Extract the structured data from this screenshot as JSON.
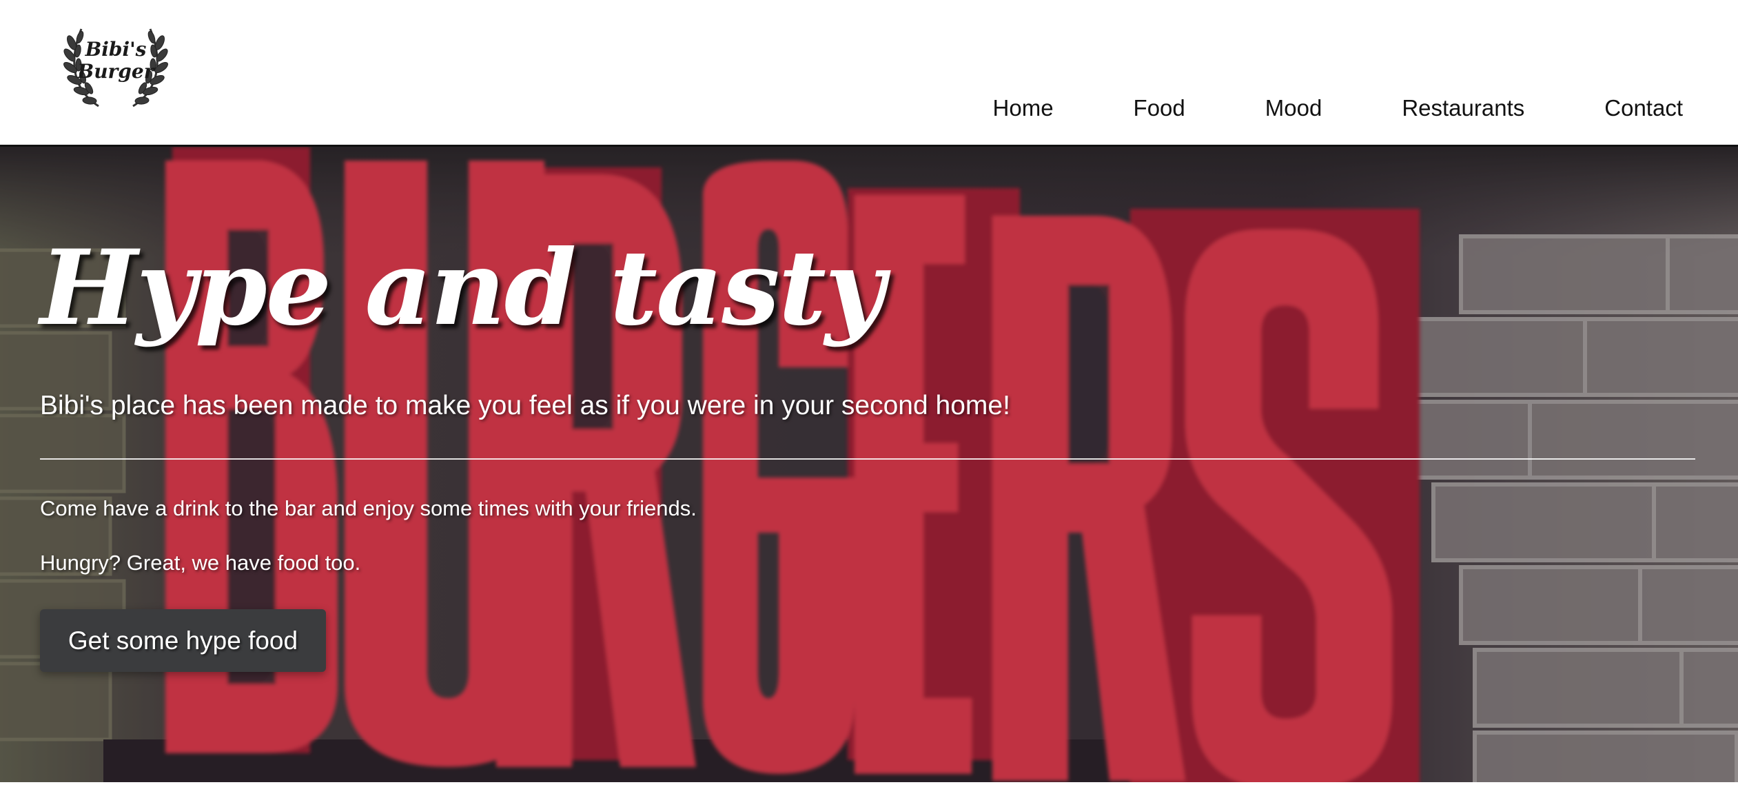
{
  "brand": {
    "line1": "Bibi's",
    "line2": "Burger",
    "icon": "laurel-wreath-icon"
  },
  "nav": {
    "items": [
      {
        "label": "Home"
      },
      {
        "label": "Food"
      },
      {
        "label": "Mood"
      },
      {
        "label": "Restaurants"
      },
      {
        "label": "Contact"
      }
    ]
  },
  "hero": {
    "title": "Hype and tasty",
    "subtitle": "Bibi's place has been made to make you feel as if you were in your second home!",
    "paragraphs": [
      "Come have a drink to the bar and enjoy some times with your friends.",
      "Hungry? Great, we have food too."
    ],
    "cta_label": "Get some hype food",
    "background_sign_text": "BURGERS"
  },
  "colors": {
    "header_bg": "#ffffff",
    "header_border": "#111111",
    "neon_red": "#ff3344",
    "button_bg": "#3b3c3e",
    "text_on_hero": "#ffffff"
  }
}
